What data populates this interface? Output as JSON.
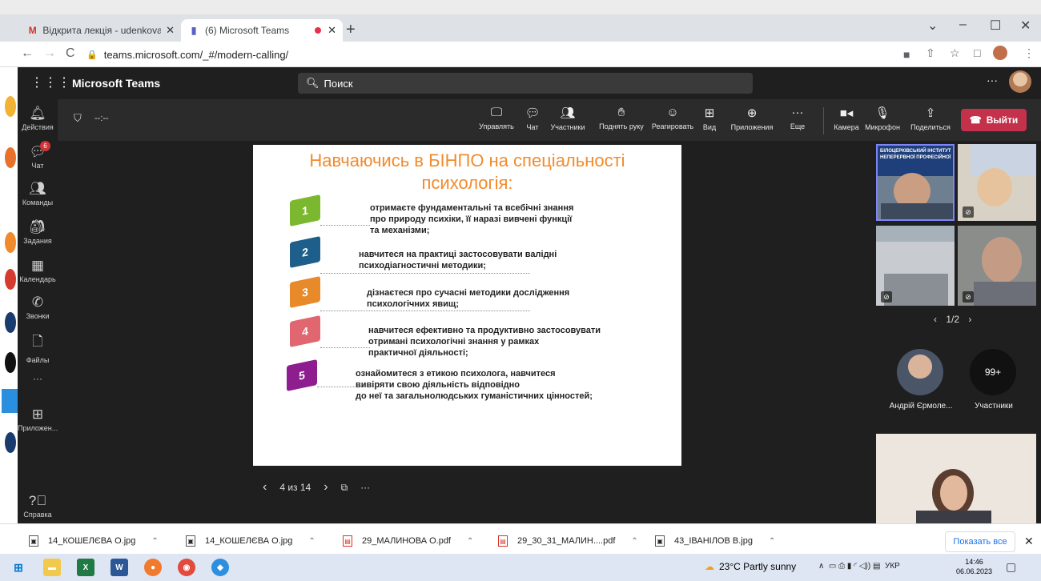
{
  "browser": {
    "tabs": [
      {
        "title": "Відкрита лекція - udenkova2017",
        "icon": "gmail-icon"
      },
      {
        "title": "(6) Microsoft Teams",
        "icon": "teams-icon",
        "recording": true
      }
    ],
    "new_tab": "+",
    "window_controls": [
      "⌄",
      "–",
      "☐",
      "✕"
    ],
    "url": "teams.microsoft.com/_#/modern-calling/"
  },
  "teams": {
    "app_title": "Microsoft Teams",
    "search_placeholder": "Поиск",
    "more": "···",
    "rail": [
      {
        "label": "Действия",
        "icon": "bell-icon"
      },
      {
        "label": "Чат",
        "icon": "chat-icon",
        "badge": "6"
      },
      {
        "label": "Команды",
        "icon": "teams-group-icon"
      },
      {
        "label": "Задания",
        "icon": "assignments-icon"
      },
      {
        "label": "Календарь",
        "icon": "calendar-icon"
      },
      {
        "label": "Звонки",
        "icon": "phone-icon"
      },
      {
        "label": "Файлы",
        "icon": "file-icon"
      },
      {
        "label": "···",
        "icon": "more-icon"
      },
      {
        "label": "Приложен...",
        "icon": "apps-icon"
      },
      {
        "label": "Справка",
        "icon": "help-icon"
      }
    ]
  },
  "meeting": {
    "timer": "--:--",
    "controls": [
      {
        "label": "Управлять",
        "icon": "manage-icon"
      },
      {
        "label": "Чат",
        "icon": "chat-icon"
      },
      {
        "label": "Участники",
        "icon": "people-icon"
      },
      {
        "label": "Поднять руку",
        "icon": "raise-hand-icon"
      },
      {
        "label": "Реагировать",
        "icon": "react-icon"
      },
      {
        "label": "Вид",
        "icon": "view-icon"
      },
      {
        "label": "Приложения",
        "icon": "add-app-icon"
      },
      {
        "label": "Еще",
        "icon": "more-icon"
      },
      {
        "label": "Камера",
        "icon": "camera-icon"
      },
      {
        "label": "Микрофон",
        "icon": "mic-off-icon"
      },
      {
        "label": "Поделиться",
        "icon": "share-icon"
      }
    ],
    "leave": "Выйти",
    "leave_color": "#c4314b"
  },
  "slide": {
    "title_line1": "Навчаючись в БІНПО на спеціальності",
    "title_line2": "психологія:",
    "title_color": "#f28b2c",
    "items": [
      {
        "num": "1",
        "color": "#7cb82f",
        "text": "отримаєте фундаментальні та всебічні знання\nпро природу психіки, її наразі вивчені функції\nта механізми;"
      },
      {
        "num": "2",
        "color": "#1d5f8a",
        "text": "навчитеся на практиці застосовувати валідні\nпсиходіагностичні методики;"
      },
      {
        "num": "3",
        "color": "#e8892a",
        "text": "дізнаєтеся про сучасні методики дослідження\nпсихологічних явищ;"
      },
      {
        "num": "4",
        "color": "#e06670",
        "text": "навчитеся ефективно та продуктивно застосовувати\nотримані  психологічні знання у рамках\n практичної діяльності;"
      },
      {
        "num": "5",
        "color": "#8e1d8f",
        "text": "ознайомитеся з етикою психолога, навчитеся\nвивіряти свою діяльність відповідно\nдо неї та загальнолюдських гуманістичних цінностей;"
      }
    ],
    "pager": "4 из 14"
  },
  "gallery": {
    "page": "1/2",
    "participant_name": "Андрій Єрмоле...",
    "participants_label": "Участники",
    "participants_count": "99+",
    "banner_text": "БІЛОЦЕРКІВСЬКИЙ ІНСТИТУТ НЕПЕРЕРВНОЇ ПРОФЕСІЙНОЇ"
  },
  "downloads": {
    "files": [
      {
        "name": "14_КОШЕЛЄВА О.jpg",
        "type": "jpg"
      },
      {
        "name": "14_КОШЕЛЄВА О.jpg",
        "type": "jpg"
      },
      {
        "name": "29_МАЛИНОВА О.pdf",
        "type": "pdf"
      },
      {
        "name": "29_30_31_МАЛИН....pdf",
        "type": "pdf"
      },
      {
        "name": "43_ІВАНІЛОВ В.jpg",
        "type": "jpg"
      }
    ],
    "show_all": "Показать все"
  },
  "taskbar": {
    "weather": "23°C  Partly sunny",
    "lang": "УКР",
    "time": "14:46",
    "date": "06.06.2023"
  }
}
